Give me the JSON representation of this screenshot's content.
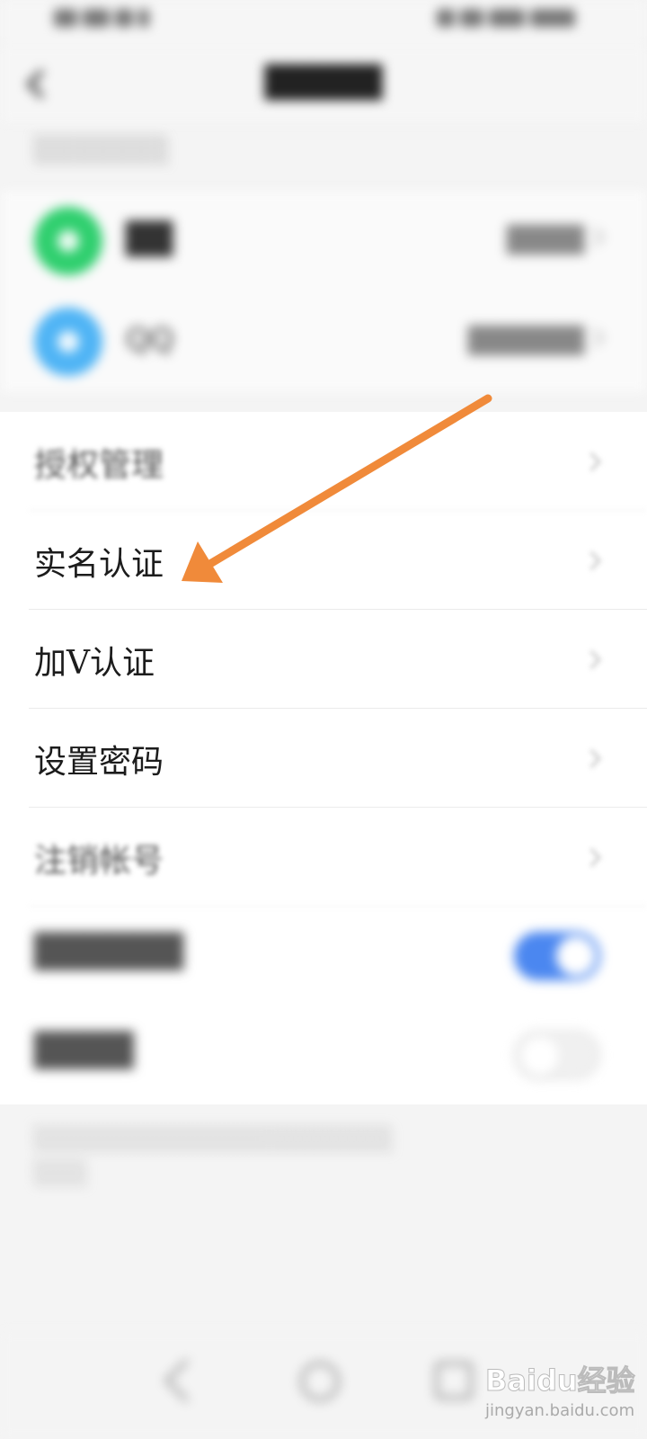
{
  "settings": {
    "items": [
      {
        "label": "授权管理"
      },
      {
        "label": "实名认证"
      },
      {
        "label": "加V认证"
      },
      {
        "label": "设置密码"
      },
      {
        "label": "注销帐号"
      }
    ],
    "toggles": [
      {
        "state": "on"
      },
      {
        "state": "off"
      }
    ]
  },
  "accounts": [
    {
      "icon": "wechat-icon",
      "color": "#2fcf6e"
    },
    {
      "icon": "qq-icon",
      "color": "#4fb4f5",
      "name": "QQ"
    }
  ],
  "annotation": {
    "color": "#f08a3a",
    "target": "实名认证"
  },
  "watermark": {
    "main": "Baidu经验",
    "sub": "jingyan.baidu.com"
  }
}
